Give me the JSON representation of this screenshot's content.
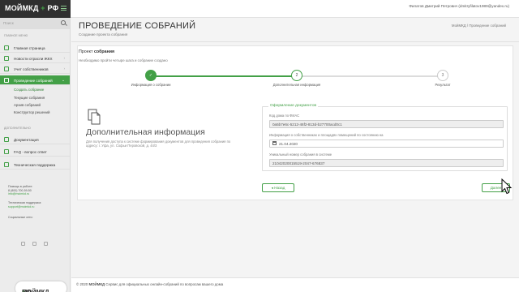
{
  "topbar": {
    "logo_main": "МОЙМКД",
    "logo_plus": "+",
    "logo_rf": "РФ",
    "user": "Филатов Дмитрий Петрович (dmitryfilatov1989@yandex.ru)"
  },
  "sidebar": {
    "search_placeholder": "Поиск",
    "section_main": "Главное меню",
    "items": [
      {
        "label": "Главная страница",
        "icon": "home-icon"
      },
      {
        "label": "Новости отрасли ЖКХ",
        "icon": "news-icon",
        "chevron": "›"
      },
      {
        "label": "Учет собственников",
        "icon": "users-icon",
        "chevron": "›"
      },
      {
        "label": "Проведение собраний",
        "icon": "meeting-icon",
        "chevron": "⌄",
        "active": true
      }
    ],
    "subitems": [
      "Создать собрание",
      "Текущие собрания",
      "Архив собраний",
      "Конструктор решений"
    ],
    "section_extra": "Дополнительно",
    "extra_items": [
      {
        "label": "Документация",
        "icon": "doc-icon"
      },
      {
        "label": "FAQ - вопрос ответ",
        "icon": "faq-icon"
      },
      {
        "label": "Техническая поддержка",
        "icon": "support-icon"
      }
    ],
    "contact_heading": "Помощь в работе:",
    "contact_phone": "8 (800) 700-59-50",
    "contact_email": "info@moimkd.ru",
    "support_heading": "Техническая поддержка:",
    "support_email": "support@moimkd.ru",
    "social_heading": "Социальные сети:",
    "social_icons": [
      "vk-icon",
      "ok-icon",
      "fb-icon"
    ]
  },
  "header": {
    "title": "ПРОВЕДЕНИЕ СОБРАНИЙ",
    "subtitle": "Создание проекта собрания",
    "breadcrumb_home": "МойМКД",
    "breadcrumb_sep": "/",
    "breadcrumb_current": "Проведение собраний"
  },
  "card": {
    "project_prefix": "Проект",
    "project_bold": "собрания",
    "hint": "Необходимо пройти четыре шага и собрание создано",
    "steps": [
      {
        "num": "✓",
        "label": "Информация о собрании",
        "state": "done"
      },
      {
        "num": "2",
        "label": "Дополнительная информация",
        "state": "current"
      },
      {
        "num": "3",
        "label": "Результат",
        "state": "todo"
      }
    ],
    "info_title": "Дополнительная информация",
    "info_desc": "Для получения доступа к системе формирования документов для проведения собрания по адресу: г. Уфа, ул. Софьи Перовской, д. 44/3",
    "fieldset_legend": "Оформление документов",
    "fields": [
      {
        "label": "Код дома по ФИАС",
        "value": "0a5b7e6c-5212-46f2-813d-b27700acd0c1"
      },
      {
        "label": "Информация о собственниках и площадях помещений по состоянию на",
        "value": "21.04.2020"
      },
      {
        "label": "Уникальный номер собрания в системе",
        "value": "21042020015519-2047-676837"
      }
    ],
    "back_label": "◂ Назад",
    "next_label": "Далее"
  },
  "footer": {
    "prefix": "© 2020",
    "brand": "МОЙМКД",
    "text": "Сервис для официальных онлайн-собраний по вопросам вашего дома"
  },
  "colors": {
    "accent": "#43a047",
    "sidebar_bg": "#ececec",
    "logo_bg": "#2f2f2f"
  }
}
